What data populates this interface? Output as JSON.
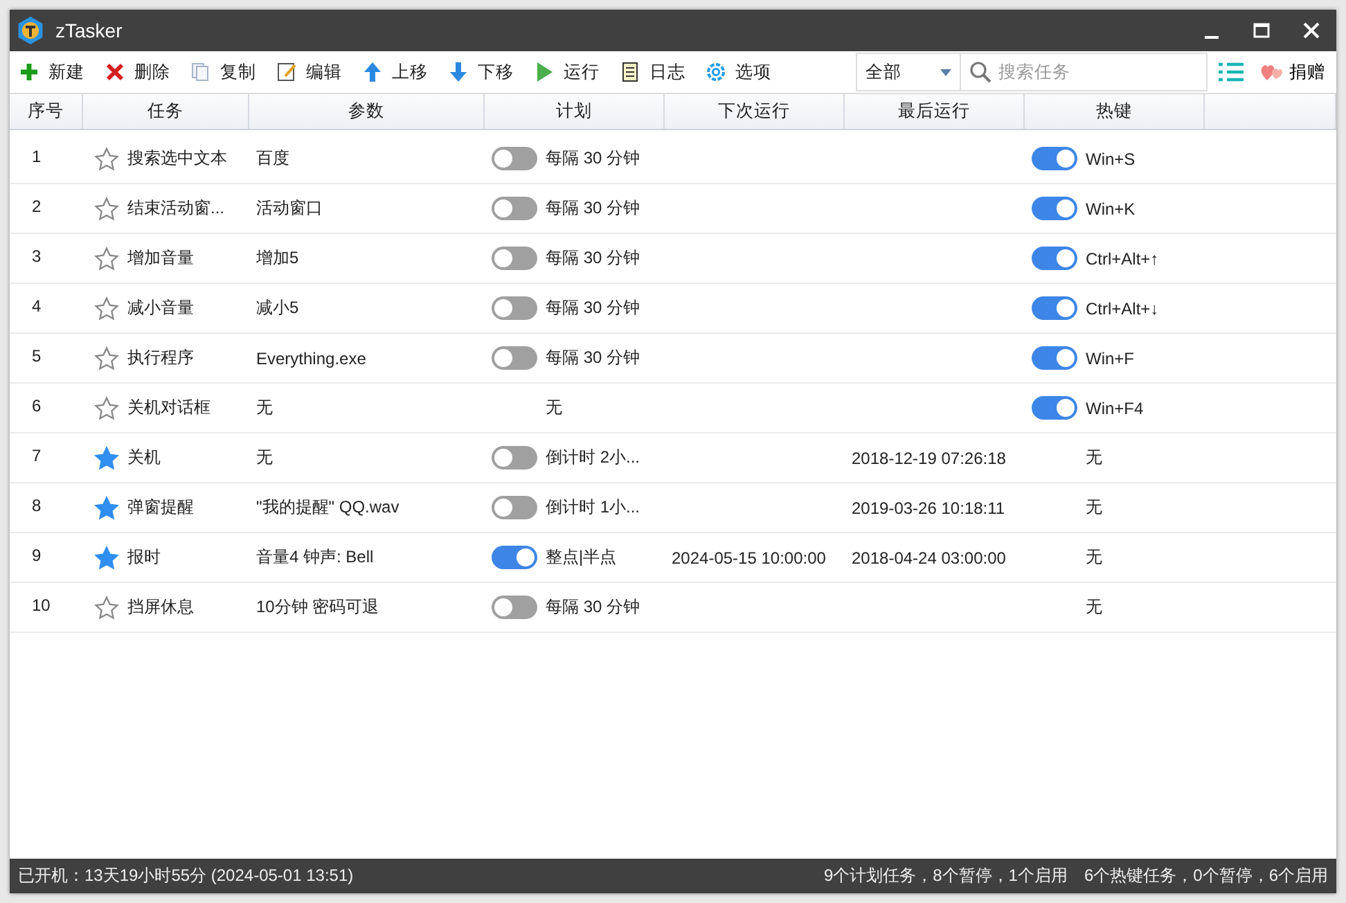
{
  "window": {
    "title": "zTasker"
  },
  "toolbar": [
    {
      "kind": "new",
      "label": "新建"
    },
    {
      "kind": "delete",
      "label": "删除"
    },
    {
      "kind": "copy",
      "label": "复制"
    },
    {
      "kind": "edit",
      "label": "编辑"
    },
    {
      "kind": "up",
      "label": "上移"
    },
    {
      "kind": "down",
      "label": "下移"
    },
    {
      "kind": "run",
      "label": "运行"
    },
    {
      "kind": "log",
      "label": "日志"
    },
    {
      "kind": "options",
      "label": "选项"
    }
  ],
  "filter": {
    "value": "全部"
  },
  "search": {
    "placeholder": "搜索任务"
  },
  "donate": {
    "label": "捐赠"
  },
  "table": {
    "columns": [
      "序号",
      "任务",
      "参数",
      "计划",
      "下次运行",
      "最后运行",
      "热键"
    ],
    "rows": [
      {
        "index": "1",
        "starred": false,
        "task": "搜索选中文本",
        "params": "百度",
        "schedule": {
          "on": false,
          "text": "每隔 30 分钟"
        },
        "next_run": "",
        "last_run": "",
        "hotkey": {
          "on": true,
          "text": "Win+S"
        }
      },
      {
        "index": "2",
        "starred": false,
        "task": "结束活动窗...",
        "params": "活动窗口",
        "schedule": {
          "on": false,
          "text": "每隔 30 分钟"
        },
        "next_run": "",
        "last_run": "",
        "hotkey": {
          "on": true,
          "text": "Win+K"
        }
      },
      {
        "index": "3",
        "starred": false,
        "task": "增加音量",
        "params": "增加5",
        "schedule": {
          "on": false,
          "text": "每隔 30 分钟"
        },
        "next_run": "",
        "last_run": "",
        "hotkey": {
          "on": true,
          "text": "Ctrl+Alt+↑"
        }
      },
      {
        "index": "4",
        "starred": false,
        "task": "减小音量",
        "params": "减小5",
        "schedule": {
          "on": false,
          "text": "每隔 30 分钟"
        },
        "next_run": "",
        "last_run": "",
        "hotkey": {
          "on": true,
          "text": "Ctrl+Alt+↓"
        }
      },
      {
        "index": "5",
        "starred": false,
        "task": "执行程序",
        "params": "Everything.exe",
        "schedule": {
          "on": false,
          "text": "每隔 30 分钟"
        },
        "next_run": "",
        "last_run": "",
        "hotkey": {
          "on": true,
          "text": "Win+F"
        }
      },
      {
        "index": "6",
        "starred": false,
        "task": "关机对话框",
        "params": "无",
        "schedule": {
          "text": "无"
        },
        "next_run": "",
        "last_run": "",
        "hotkey": {
          "on": true,
          "text": "Win+F4"
        }
      },
      {
        "index": "7",
        "starred": true,
        "task": "关机",
        "params": "无",
        "schedule": {
          "on": false,
          "text": "倒计时 2小..."
        },
        "next_run": "",
        "last_run": "2018-12-19 07:26:18",
        "hotkey": {
          "text": "无"
        }
      },
      {
        "index": "8",
        "starred": true,
        "task": "弹窗提醒",
        "params": "\"我的提醒\" QQ.wav",
        "schedule": {
          "on": false,
          "text": "倒计时 1小..."
        },
        "next_run": "",
        "last_run": "2019-03-26 10:18:11",
        "hotkey": {
          "text": "无"
        }
      },
      {
        "index": "9",
        "starred": true,
        "task": "报时",
        "params": "音量4 钟声: Bell",
        "schedule": {
          "on": true,
          "text": "整点|半点"
        },
        "next_run": "2024-05-15 10:00:00",
        "last_run": "2018-04-24 03:00:00",
        "hotkey": {
          "text": "无"
        }
      },
      {
        "index": "10",
        "starred": false,
        "task": "挡屏休息",
        "params": "10分钟 密码可退",
        "schedule": {
          "on": false,
          "text": "每隔 30 分钟"
        },
        "next_run": "",
        "last_run": "",
        "hotkey": {
          "text": "无"
        }
      }
    ]
  },
  "status_bar": {
    "uptime": "已开机：13天19小时55分 (2024-05-01 13:51)",
    "summary": "9个计划任务，8个暂停，1个启用　6个热键任务，0个暂停，6个启用"
  }
}
